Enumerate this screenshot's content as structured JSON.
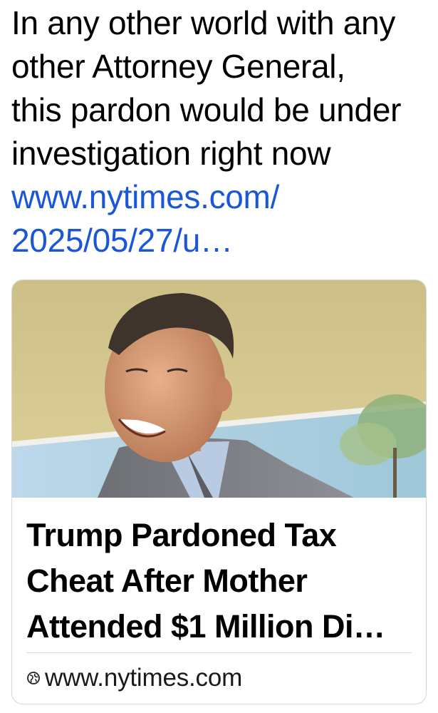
{
  "post": {
    "text_lines": [
      "In any other world with any",
      "other Attorney General,",
      "this pardon would be under",
      "investigation right now"
    ],
    "link_lines": [
      "www.nytimes.com/",
      "2025/05/27/u…"
    ]
  },
  "link_card": {
    "image_description_icon": "photo-thumbnail",
    "title_lines": [
      "Trump Pardoned Tax",
      "Cheat After Mother",
      "Attended $1 Million Di…"
    ],
    "domain": "www.nytimes.com",
    "domain_icon": "globe-icon"
  }
}
